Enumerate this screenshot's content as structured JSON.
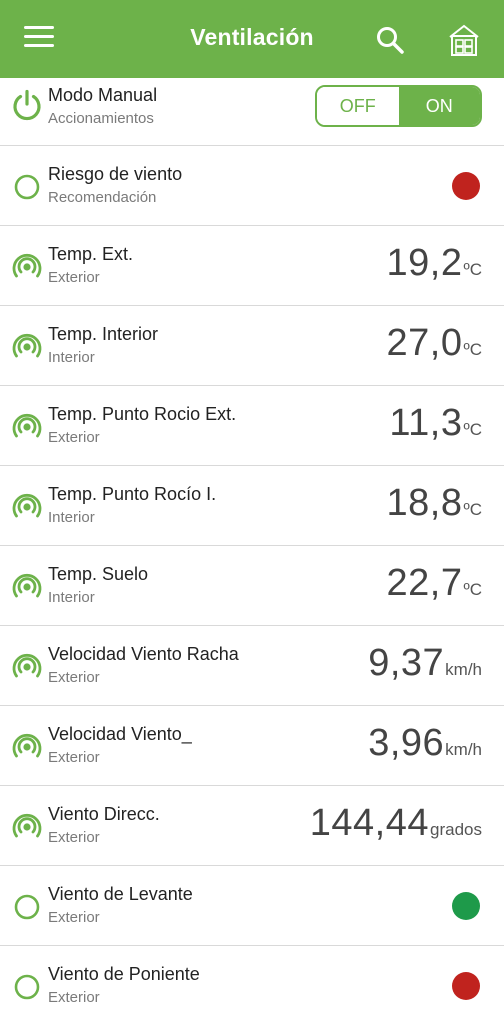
{
  "header": {
    "title": "Ventilación",
    "menu_icon": "menu-icon",
    "search_icon": "search-icon",
    "home_icon": "home-icon"
  },
  "colors": {
    "accent": "#6db24a",
    "red": "#c0231e",
    "green": "#1e9a4a"
  },
  "manual": {
    "name": "Modo Manual",
    "sub": "Accionamientos",
    "off_label": "OFF",
    "on_label": "ON",
    "selected": "ON"
  },
  "wind_risk": {
    "name": "Riesgo de viento",
    "sub": "Recomendación",
    "status": "red"
  },
  "sensors": [
    {
      "name": "Temp. Ext.",
      "sub": "Exterior",
      "value": "19,2",
      "unit": "ºC"
    },
    {
      "name": "Temp. Interior",
      "sub": "Interior",
      "value": "27,0",
      "unit": "ºC"
    },
    {
      "name": "Temp. Punto Rocio Ext.",
      "sub": "Exterior",
      "value": "11,3",
      "unit": "ºC"
    },
    {
      "name": "Temp. Punto Rocío I.",
      "sub": "Interior",
      "value": "18,8",
      "unit": "ºC"
    },
    {
      "name": "Temp. Suelo",
      "sub": "Interior",
      "value": "22,7",
      "unit": "ºC"
    },
    {
      "name": "Velocidad Viento Racha",
      "sub": "Exterior",
      "value": "9,37",
      "unit": "km/h"
    },
    {
      "name": "Velocidad Viento_",
      "sub": "Exterior",
      "value": "3,96",
      "unit": "km/h"
    },
    {
      "name": "Viento Direcc.",
      "sub": "Exterior",
      "value": "144,44",
      "unit": "grados"
    }
  ],
  "levante": {
    "name": "Viento de Levante",
    "sub": "Exterior",
    "status": "green"
  },
  "poniente": {
    "name": "Viento de Poniente",
    "sub": "Exterior",
    "status": "red"
  }
}
